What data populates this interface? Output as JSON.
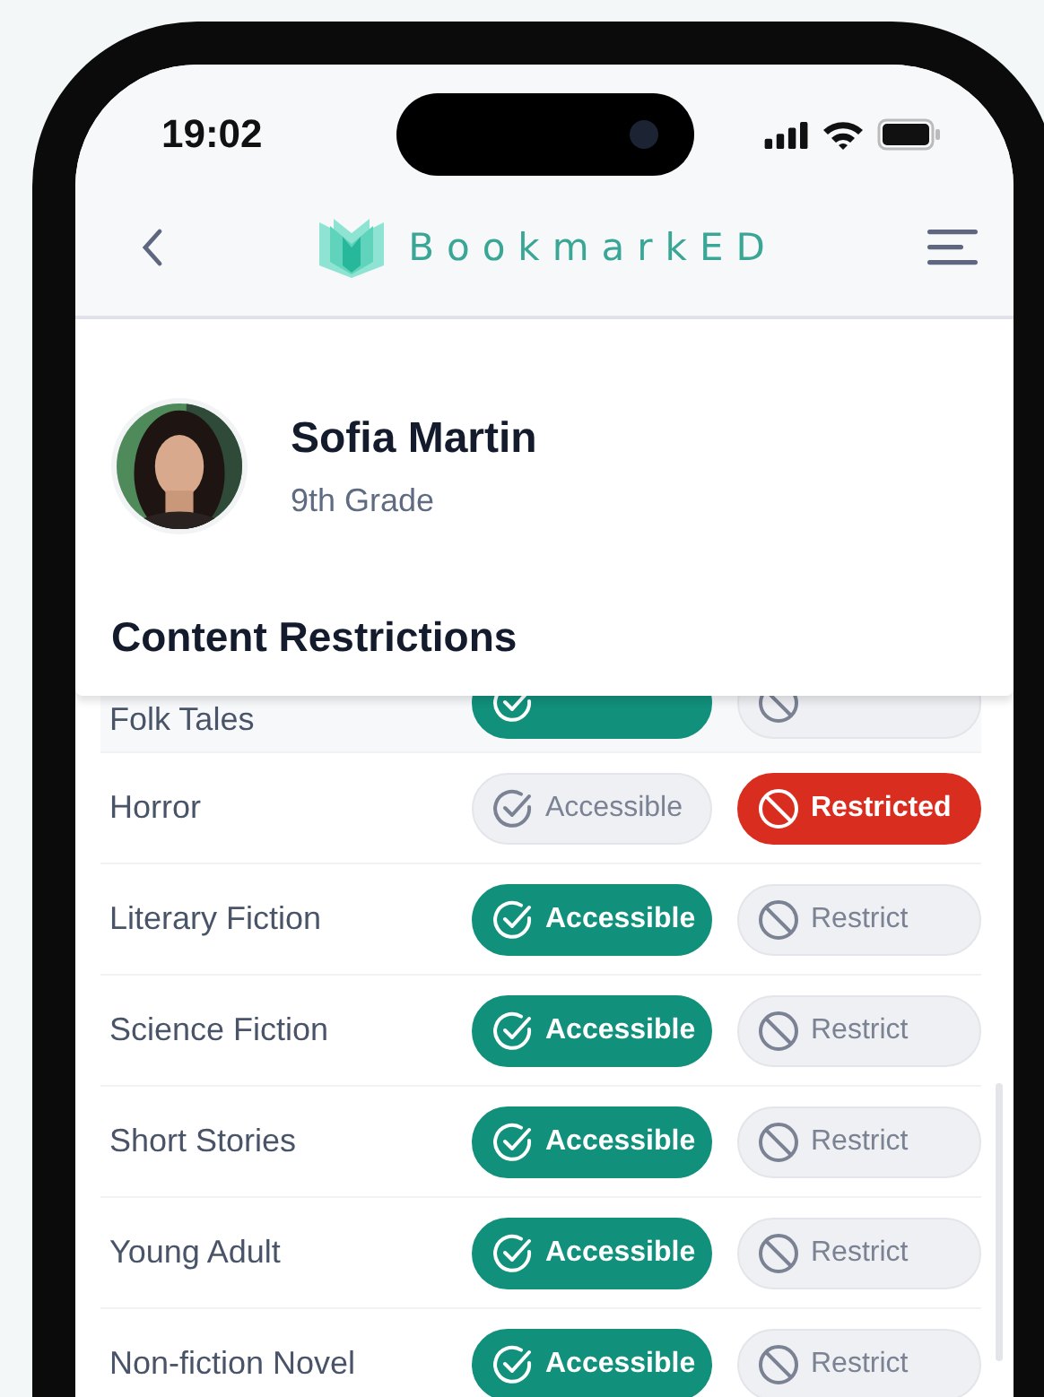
{
  "status_bar": {
    "time": "19:02"
  },
  "nav": {
    "brand": "BookmarkED"
  },
  "student": {
    "name": "Sofia Martin",
    "grade": "9th Grade"
  },
  "section_title": "Content Restrictions",
  "genres": [
    {
      "name": "Folk Tales",
      "restricted": false
    },
    {
      "name": "Horror",
      "restricted": true,
      "accessible_label": "Accessible",
      "restrict_label": "Restricted"
    },
    {
      "name": "Literary Fiction",
      "restricted": false,
      "accessible_label": "Accessible",
      "restrict_label": "Restrict"
    },
    {
      "name": "Science Fiction",
      "restricted": false,
      "accessible_label": "Accessible",
      "restrict_label": "Restrict"
    },
    {
      "name": "Short Stories",
      "restricted": false,
      "accessible_label": "Accessible",
      "restrict_label": "Restrict"
    },
    {
      "name": "Young Adult",
      "restricted": false,
      "accessible_label": "Accessible",
      "restrict_label": "Restrict"
    },
    {
      "name": "Non-fiction Novel",
      "restricted": false,
      "accessible_label": "Accessible",
      "restrict_label": "Restrict"
    }
  ]
}
